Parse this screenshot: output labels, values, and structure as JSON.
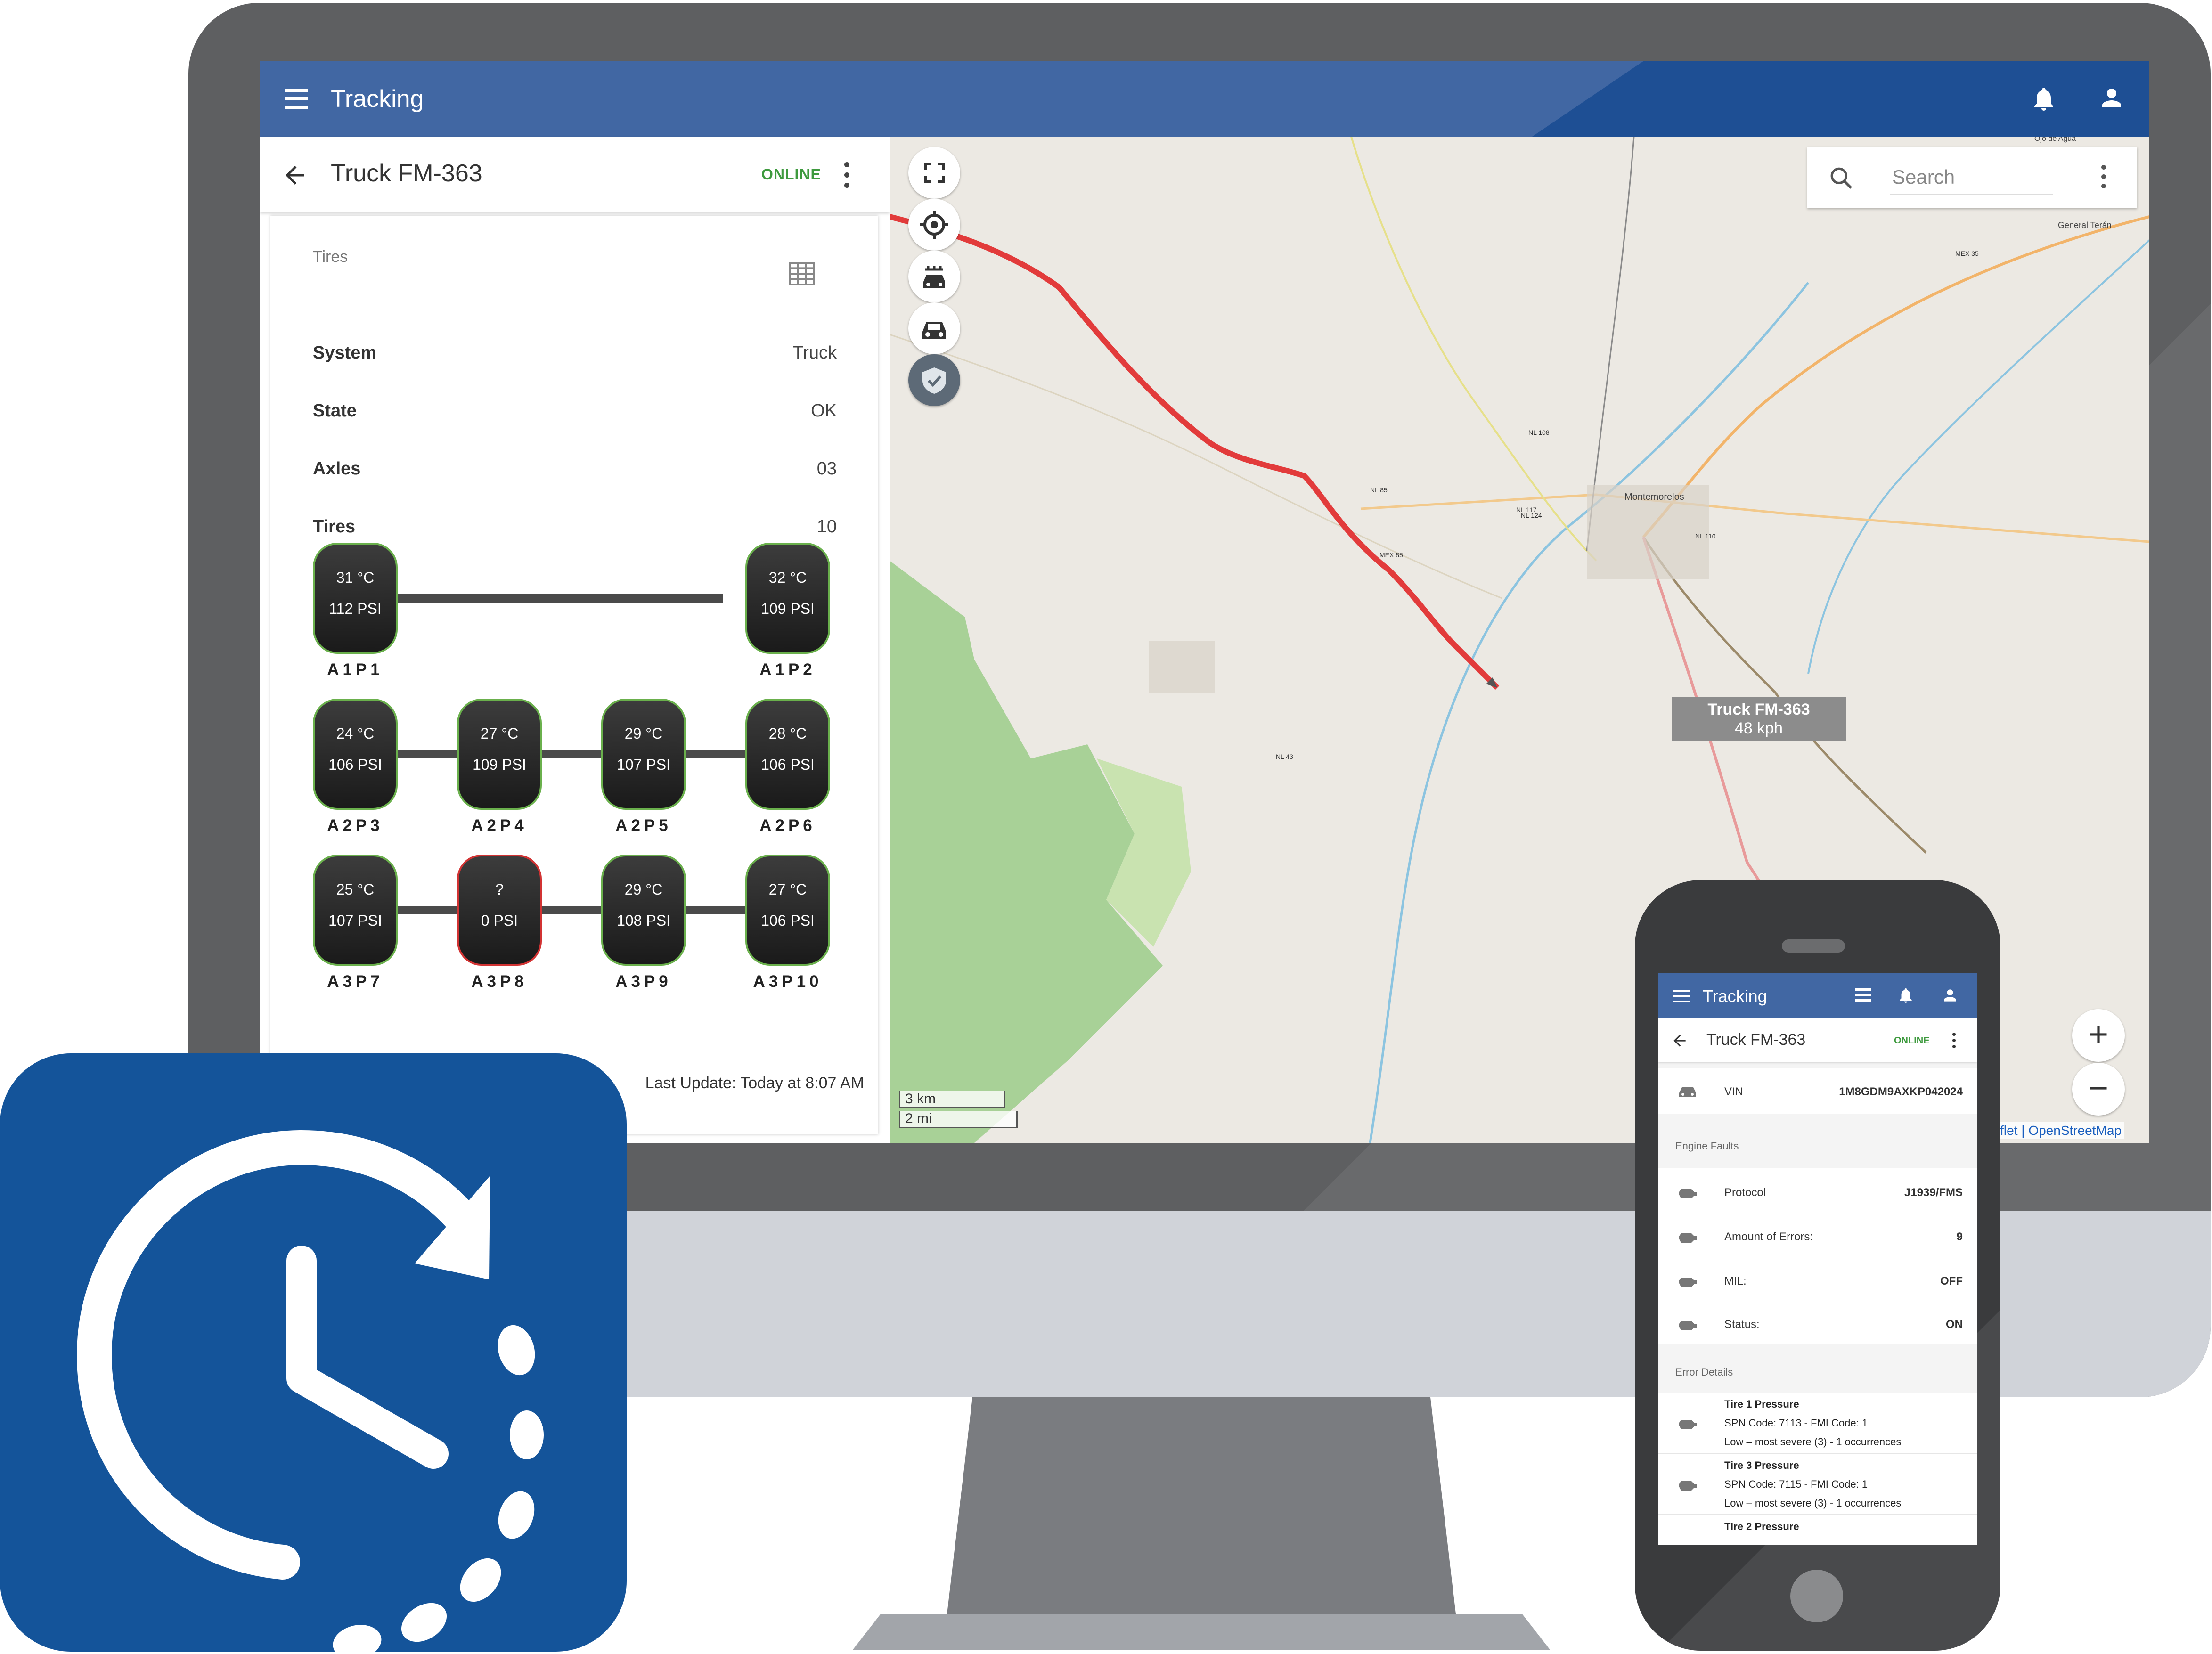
{
  "app": {
    "title": "Tracking"
  },
  "vehicle": {
    "title": "Truck FM-363",
    "status": "ONLINE"
  },
  "tires_panel": {
    "heading": "Tires",
    "rows": [
      {
        "label": "System",
        "value": "Truck"
      },
      {
        "label": "State",
        "value": "OK"
      },
      {
        "label": "Axles",
        "value": "03"
      },
      {
        "label": "Tires",
        "value": "10"
      }
    ],
    "axles": [
      {
        "tires": [
          {
            "label": "A1P1",
            "temp": "31 °C",
            "psi": "112 PSI",
            "alert": false
          },
          {
            "label": "A1P2",
            "temp": "32 °C",
            "psi": "109 PSI",
            "alert": false
          }
        ]
      },
      {
        "tires": [
          {
            "label": "A2P3",
            "temp": "24 °C",
            "psi": "106 PSI",
            "alert": false
          },
          {
            "label": "A2P4",
            "temp": "27 °C",
            "psi": "109 PSI",
            "alert": false
          },
          {
            "label": "A2P5",
            "temp": "29 °C",
            "psi": "107 PSI",
            "alert": false
          },
          {
            "label": "A2P6",
            "temp": "28 °C",
            "psi": "106 PSI",
            "alert": false
          }
        ]
      },
      {
        "tires": [
          {
            "label": "A3P7",
            "temp": "25 °C",
            "psi": "107 PSI",
            "alert": false
          },
          {
            "label": "A3P8",
            "temp": "?",
            "psi": "0 PSI",
            "alert": true
          },
          {
            "label": "A3P9",
            "temp": "29 °C",
            "psi": "108 PSI",
            "alert": false
          },
          {
            "label": "A3P10",
            "temp": "27 °C",
            "psi": "106 PSI",
            "alert": false
          }
        ]
      }
    ],
    "last_update": "Last Update: Today at 8:07 AM"
  },
  "map": {
    "search_placeholder": "Search",
    "popup": {
      "name": "Truck FM-363",
      "speed": "48 kph"
    },
    "scale_km": "3 km",
    "scale_mi": "2 mi",
    "attribution": "eaflet | OpenStreetMap",
    "place_labels": [
      "Montemorelos",
      "General Terán",
      "Ojo de Agua"
    ],
    "road_labels": [
      "NL 85",
      "NL 117",
      "NL 124",
      "MEX 85",
      "NL 108",
      "NL 110",
      "NL 43",
      "MEX 35"
    ],
    "colors": {
      "route": "#e23b3b",
      "land": "#ece9e3",
      "forest": "#9ccc8a"
    }
  },
  "phone": {
    "app_title": "Tracking",
    "vehicle_title": "Truck FM-363",
    "status": "ONLINE",
    "vin_label": "VIN",
    "vin_value": "1M8GDM9AXKP042024",
    "engine_faults_heading": "Engine Faults",
    "engine_rows": [
      {
        "label": "Protocol",
        "value": "J1939/FMS"
      },
      {
        "label": "Amount of Errors:",
        "value": "9"
      },
      {
        "label": "MIL:",
        "value": "OFF"
      },
      {
        "label": "Status:",
        "value": "ON"
      }
    ],
    "error_details_heading": "Error Details",
    "errors": [
      {
        "title": "Tire 1 Pressure",
        "codes": "SPN Code: 7113 - FMI Code: 1",
        "severity": "Low – most severe (3) - 1 occurrences"
      },
      {
        "title": "Tire 3 Pressure",
        "codes": "SPN Code: 7115 - FMI Code: 1",
        "severity": "Low – most severe (3) - 1 occurrences"
      },
      {
        "title": "Tire 2 Pressure",
        "codes": "",
        "severity": ""
      }
    ]
  },
  "brand": {
    "primary": "#4167a3",
    "dark": "#14549a",
    "ok": "#3e9a3e",
    "alert": "#d23333"
  }
}
